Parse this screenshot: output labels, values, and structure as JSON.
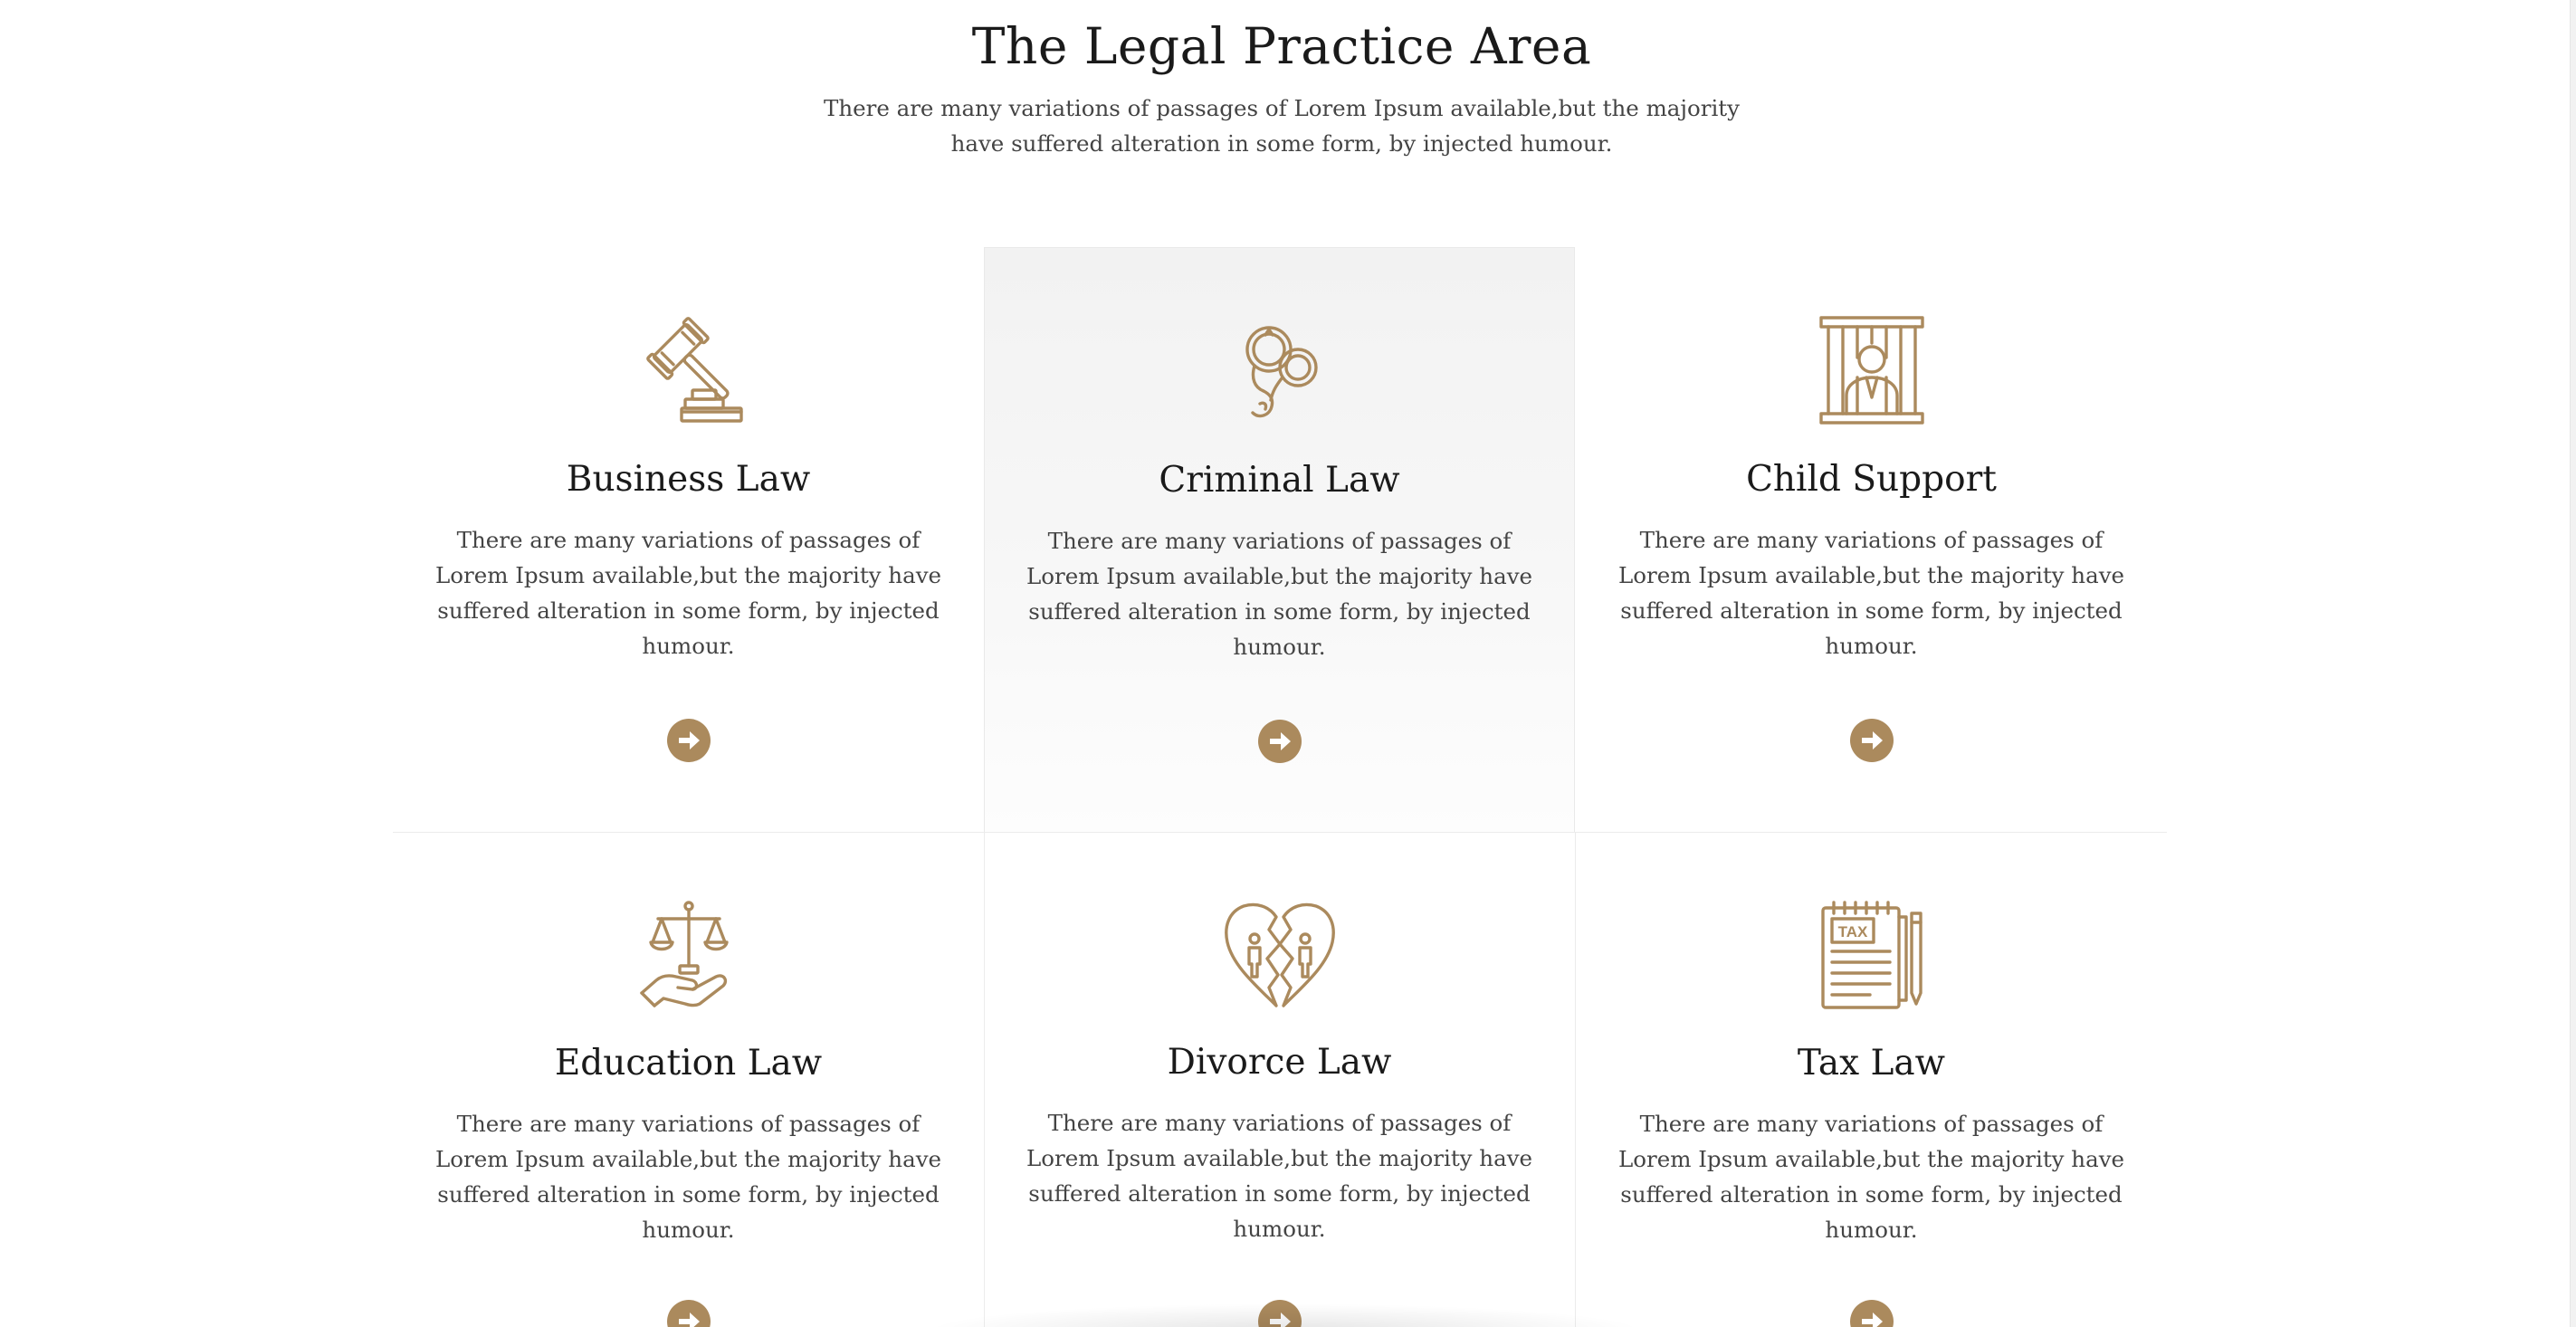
{
  "header": {
    "title": "The Legal Practice Area",
    "subtitle": "There are many variations of passages of Lorem Ipsum available,but the majority have suffered alteration in some form, by injected humour."
  },
  "theme": {
    "accent": "#ab8a5d",
    "active_card_bg": "#f3f3f3",
    "text": "#444444",
    "heading": "#1a1a1a"
  },
  "practice_areas": [
    {
      "title": "Business Law",
      "icon": "gavel-icon",
      "description": "There are many variations of passages of Lorem Ipsum available,but the majority have suffered alteration in some form, by injected humour."
    },
    {
      "title": "Criminal Law",
      "icon": "handcuffs-icon",
      "description": "There are many variations of passages of Lorem Ipsum available,but the majority have suffered alteration in some form, by injected humour."
    },
    {
      "title": "Child Support",
      "icon": "prison-cell-icon",
      "description": "There are many variations of passages of Lorem Ipsum available,but the majority have suffered alteration in some form, by injected humour."
    },
    {
      "title": "Education Law",
      "icon": "scales-hand-icon",
      "description": "There are many variations of passages of Lorem Ipsum available,but the majority have suffered alteration in some form, by injected humour."
    },
    {
      "title": "Divorce Law",
      "icon": "broken-heart-icon",
      "description": "There are many variations of passages of Lorem Ipsum available,but the majority have suffered alteration in some form, by injected humour."
    },
    {
      "title": "Tax Law",
      "icon": "tax-document-icon",
      "description": "There are many variations of passages of Lorem Ipsum available,but the majority have suffered alteration in some form, by injected humour."
    }
  ],
  "icon_labels": {
    "tax_text": "TAX"
  }
}
